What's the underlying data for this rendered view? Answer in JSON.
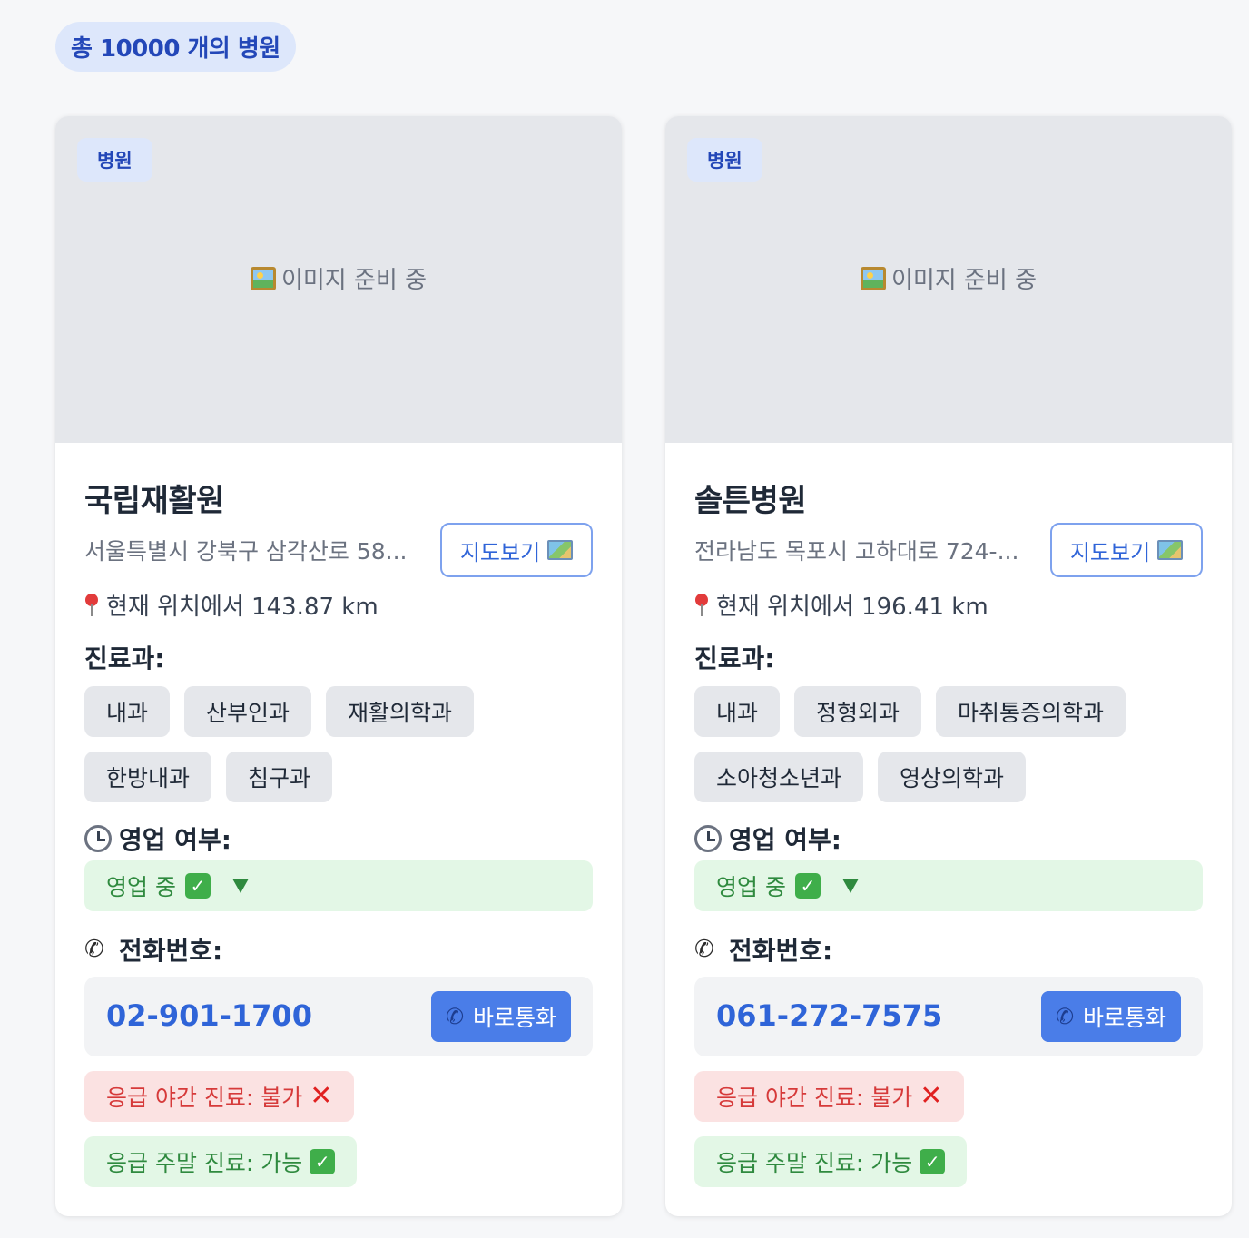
{
  "summary": {
    "count_label": "총 10000 개의 병원"
  },
  "common": {
    "image_placeholder": "이미지 준비 중",
    "map_button": "지도보기",
    "dept_label": "진료과:",
    "hours_label": "영업 여부:",
    "phone_label": "전화번호:",
    "call_button": "바로통화"
  },
  "hospitals": [
    {
      "type": "병원",
      "name": "국립재활원",
      "address": "서울특별시 강북구 삼각산로 58...",
      "distance": "현재 위치에서 143.87 km",
      "departments": [
        "내과",
        "산부인과",
        "재활의학과",
        "한방내과",
        "침구과"
      ],
      "status": "영업 중",
      "phone": "02-901-1700",
      "night_emergency": "응급 야간 진료: 불가",
      "weekend_emergency": "응급 주말 진료: 가능"
    },
    {
      "type": "병원",
      "name": "솔튼병원",
      "address": "전라남도 목포시 고하대로 724-...",
      "distance": "현재 위치에서 196.41 km",
      "departments": [
        "내과",
        "정형외과",
        "마취통증의학과",
        "소아청소년과",
        "영상의학과"
      ],
      "status": "영업 중",
      "phone": "061-272-7575",
      "night_emergency": "응급 야간 진료: 불가",
      "weekend_emergency": "응급 주말 진료: 가능"
    }
  ],
  "colors": {
    "accent": "#2f64d8",
    "call_button_bg": "#4a7de8",
    "open_bg": "#e3f7e6",
    "closed_bg": "#fbe2e2"
  },
  "icons": [
    "picture-icon",
    "map-icon",
    "pin-icon",
    "clock-icon",
    "check-icon",
    "triangle-down-icon",
    "phone-icon",
    "x-icon"
  ]
}
